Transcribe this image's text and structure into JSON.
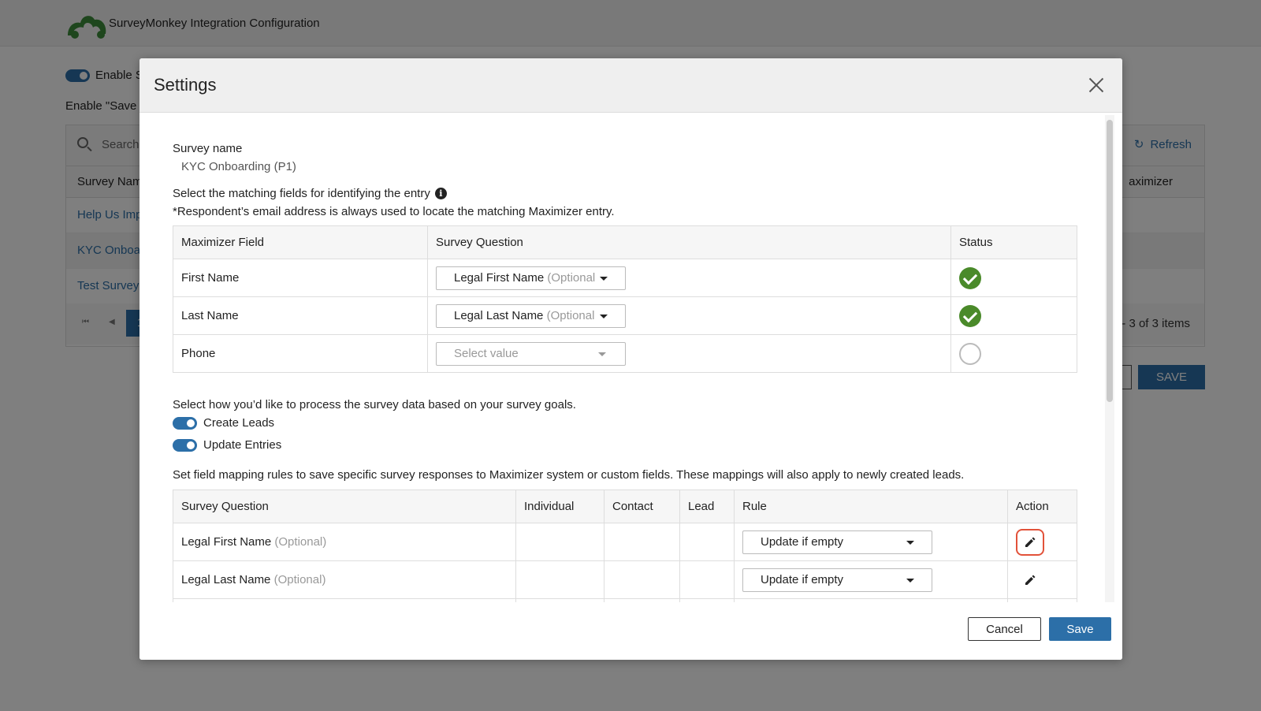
{
  "background": {
    "app_title": "SurveyMonkey Integration Configuration",
    "enable_label": "Enable S",
    "enable_save_label": "Enable \"Save I",
    "search_placeholder": "Search",
    "refresh_label": "Refresh",
    "col_survey_name": "Survey Nam",
    "col_maximizer": "aximizer",
    "rows": [
      "Help Us Imp",
      "KYC Onboar",
      "Test Survey"
    ],
    "pager_page": "1",
    "pager_info": "- 3 of 3 items",
    "save_label": "SAVE"
  },
  "dialog": {
    "title": "Settings",
    "survey_name_label": "Survey name",
    "survey_name_value": "KYC Onboarding (P1)",
    "match_label": "Select the matching fields for identifying the entry",
    "match_note": "*Respondent’s email address is always used to locate the matching Maximizer entry.",
    "match_table": {
      "headers": [
        "Maximizer Field",
        "Survey Question",
        "Status"
      ],
      "rows": [
        {
          "field": "First Name",
          "question": "Legal First Name",
          "optional": "(Optional",
          "status": "matched"
        },
        {
          "field": "Last Name",
          "question": "Legal Last Name",
          "optional": "(Optional",
          "status": "matched"
        },
        {
          "field": "Phone",
          "placeholder": "Select value",
          "status": "unmatched"
        }
      ]
    },
    "process_label": "Select how you’d like to process the survey data based on your survey goals.",
    "toggles": [
      {
        "label": "Create Leads",
        "on": true
      },
      {
        "label": "Update Entries",
        "on": true
      }
    ],
    "mapping_label": "Set field mapping rules to save specific survey responses to Maximizer system or custom fields. These mappings will also apply to newly created leads.",
    "mapping_table": {
      "headers": [
        "Survey Question",
        "Individual",
        "Contact",
        "Lead",
        "Rule",
        "Action"
      ],
      "rows": [
        {
          "question": "Legal First Name",
          "optional": "(Optional)",
          "rule": "Update if empty"
        },
        {
          "question": "Legal Last Name",
          "optional": "(Optional)",
          "rule": "Update if empty"
        }
      ]
    },
    "cancel_label": "Cancel",
    "save_label": "Save"
  },
  "colors": {
    "accent": "#2c6fa8",
    "success": "#4a8a2a",
    "focus_ring": "#e2523a"
  },
  "icons": [
    "surveymonkey-logo",
    "search-icon",
    "refresh-icon",
    "info-icon",
    "close-icon",
    "chevron-down-icon",
    "check-circle-icon",
    "pencil-icon"
  ]
}
